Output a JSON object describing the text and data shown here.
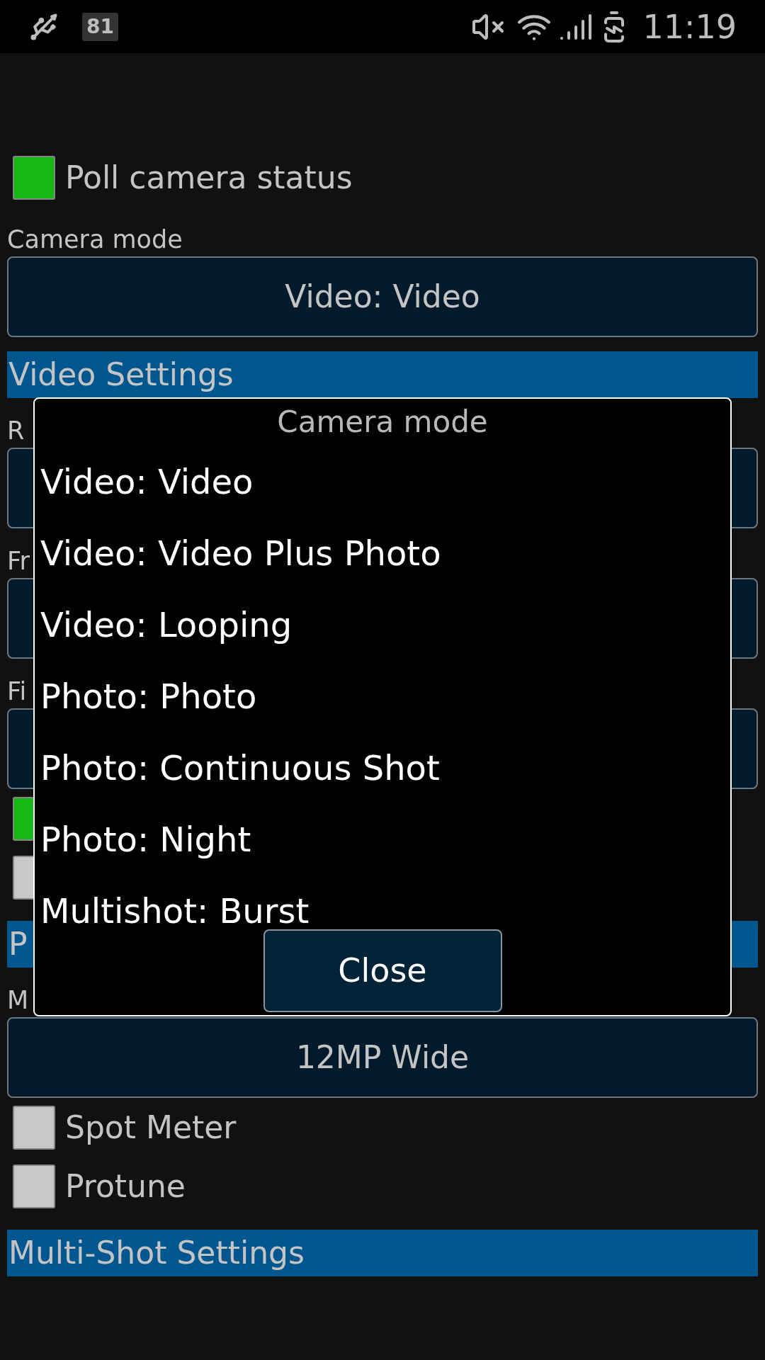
{
  "status_bar": {
    "notification_badge": "81",
    "time": "11:19"
  },
  "settings": [
    {
      "kind": "checkbox",
      "label": "Poll camera status",
      "checked": true
    },
    {
      "kind": "select",
      "label": "Camera mode",
      "value": "Video: Video"
    },
    {
      "kind": "header",
      "label": "Video Settings"
    },
    {
      "kind": "select",
      "label": "R"
    },
    {
      "kind": "select",
      "label": "Fr"
    },
    {
      "kind": "select",
      "label": "Fi"
    },
    {
      "kind": "checkbox",
      "checked": true
    },
    {
      "kind": "checkbox",
      "checked": false
    },
    {
      "kind": "header",
      "label": "P"
    },
    {
      "kind": "select",
      "label": "M",
      "value": "12MP Wide"
    },
    {
      "kind": "checkbox",
      "label": "Spot Meter",
      "checked": false
    },
    {
      "kind": "checkbox",
      "label": "Protune",
      "checked": false
    },
    {
      "kind": "header",
      "label": "Multi-Shot Settings"
    }
  ],
  "dialog": {
    "title": "Camera mode",
    "options": [
      "Video: Video",
      "Video: Video Plus Photo",
      "Video: Looping",
      "Photo: Photo",
      "Photo: Continuous Shot",
      "Photo: Night",
      "Multishot: Burst"
    ],
    "button": "Close"
  }
}
